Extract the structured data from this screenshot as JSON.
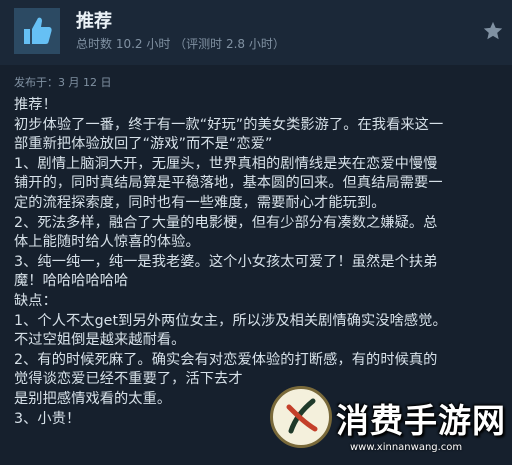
{
  "review": {
    "verdict": "推荐",
    "hours": "总时数 10.2 小时 （评测时 2.8 小时）",
    "posted": "发布于：3 月 12 日",
    "thumb_icon": "thumbs-up-icon",
    "award_icon": "star-award-icon",
    "lines": [
      "推荐！",
      "初步体验了一番，终于有一款“好玩”的美女类影游了。在我看来这一",
      "部重新把体验放回了“游戏”而不是“恋爱”",
      "1、剧情上脑洞大开，无厘头，世界真相的剧情线是夹在恋爱中慢慢",
      "铺开的，同时真结局算是平稳落地，基本圆的回来。但真结局需要一",
      "定的流程探索度，同时也有一些难度，需要耐心才能玩到。",
      "2、死法多样，融合了大量的电影梗，但有少部分有凑数之嫌疑。总",
      "体上能随时给人惊喜的体验。",
      "3、纯一纯一，纯一是我老婆。这个小女孩太可爱了！虽然是个扶弟",
      "魔！哈哈哈哈哈哈",
      "缺点：",
      "1、个人不太get到另外两位女主，所以涉及相关剧情确实没啥感觉。",
      "不过空姐倒是越来越耐看。",
      "2、有的时候死麻了。确实会有对恋爱体验的打断感，有的时候真的",
      "觉得谈恋爱已经不重要了，活下去才",
      "是别把感情戏看的太重。",
      "3、小贵！"
    ]
  },
  "watermark": {
    "title": "消费手游网",
    "url": "www.xinnanwang.com"
  },
  "colors": {
    "background": "#16202d",
    "header": "#1b2838",
    "thumb_bg": "#2c4a63",
    "thumb_icon": "#66c0f4"
  }
}
